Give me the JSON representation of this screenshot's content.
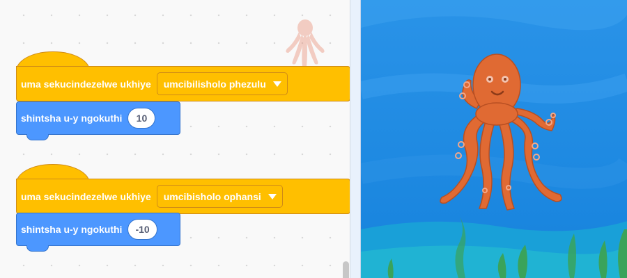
{
  "workspace": {
    "scripts": [
      {
        "hat_label": "uma sekucindezelwe ukhiye",
        "key_option": "umcibilisholo phezulu",
        "motion_label": "shintsha u-y ngokuthi",
        "motion_value": "10"
      },
      {
        "hat_label": "uma sekucindezelwe ukhiye",
        "key_option": "umcibisholo ophansi",
        "motion_label": "shintsha u-y ngokuthi",
        "motion_value": "-10"
      }
    ],
    "sprite_icon": "octopus-icon"
  },
  "stage": {
    "sprite_icon": "octopus-icon",
    "backdrop": "underwater",
    "colors": {
      "water": "#1f8ee6",
      "octopus": "#e06a33",
      "seaweed": "#3aa35a"
    }
  },
  "colors": {
    "events": "#ffbf00",
    "motion": "#4c97ff"
  }
}
